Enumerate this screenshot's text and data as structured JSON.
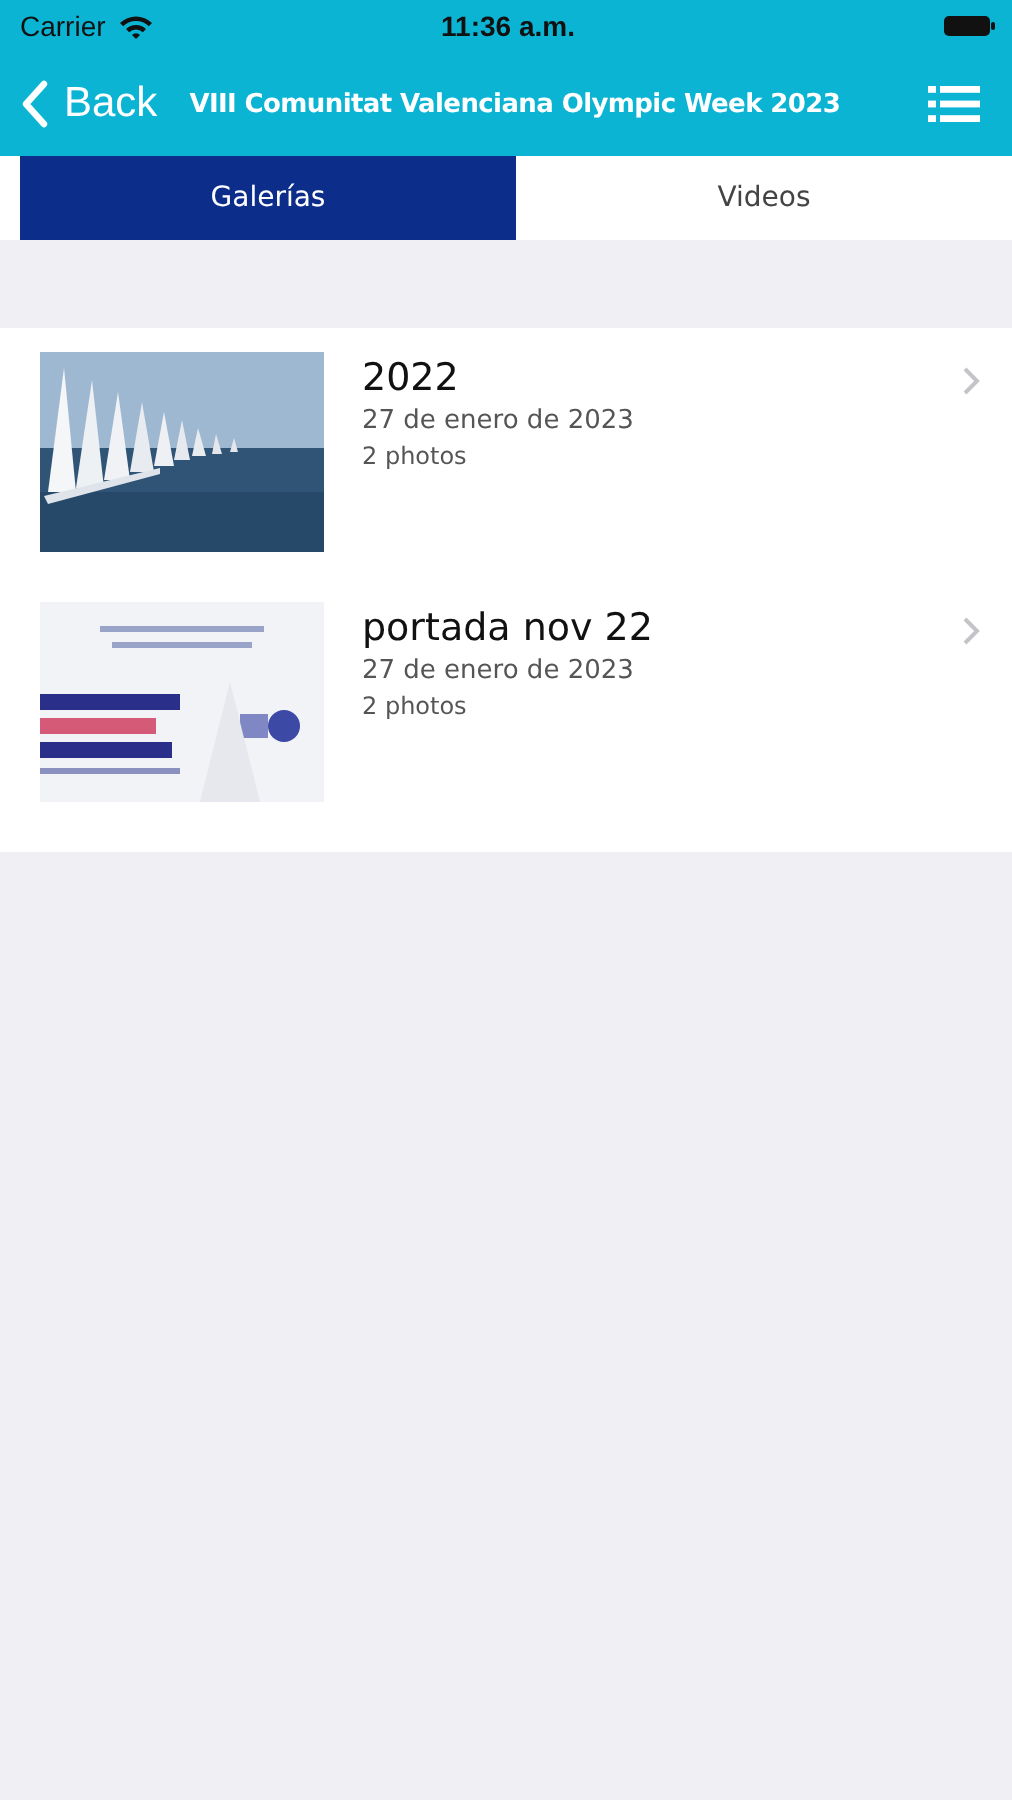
{
  "status_bar": {
    "carrier": "Carrier",
    "time": "11:36 a.m."
  },
  "nav": {
    "back": "Back",
    "title": "VIII Comunitat Valenciana Olympic Week 2023"
  },
  "tabs": [
    {
      "label": "Galerías",
      "selected": true
    },
    {
      "label": "Videos",
      "selected": false
    }
  ],
  "galleries": [
    {
      "title": "2022",
      "date": "27 de enero de 2023",
      "count": "2 photos"
    },
    {
      "title": "portada nov 22",
      "date": "27 de enero de 2023",
      "count": "2 photos"
    }
  ]
}
